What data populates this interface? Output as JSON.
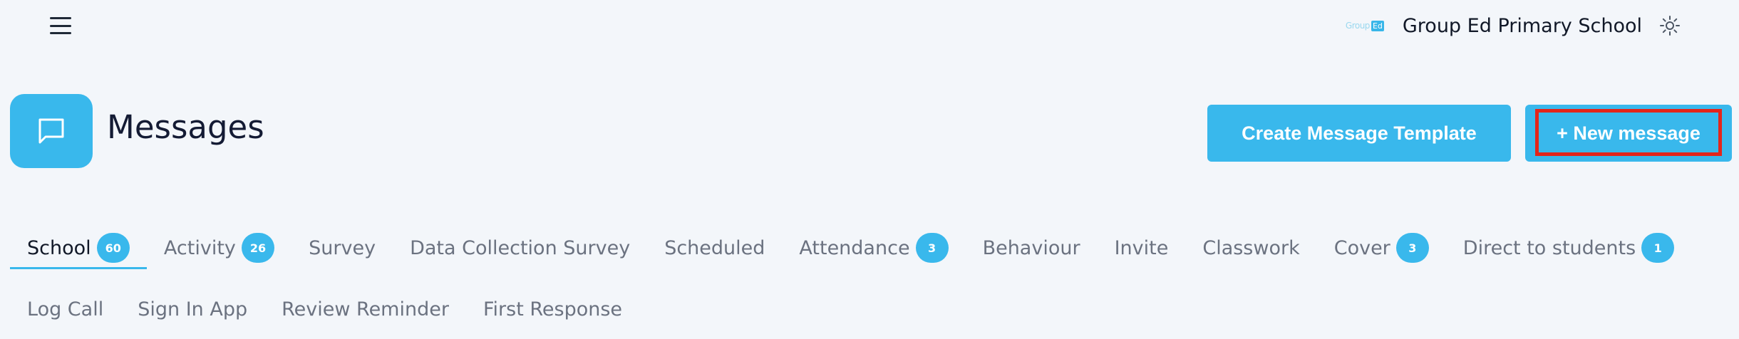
{
  "topbar": {
    "school_logo": {
      "group": "Group",
      "ed": "Ed"
    },
    "school_name": "Group Ed Primary School"
  },
  "header": {
    "title": "Messages",
    "create_template_label": "Create Message Template",
    "new_message_label": "+ New message"
  },
  "tabs": {
    "row1": [
      {
        "label": "School",
        "badge": "60",
        "active": true
      },
      {
        "label": "Activity",
        "badge": "26"
      },
      {
        "label": "Survey"
      },
      {
        "label": "Data Collection Survey"
      },
      {
        "label": "Scheduled"
      },
      {
        "label": "Attendance",
        "badge": "3"
      },
      {
        "label": "Behaviour"
      },
      {
        "label": "Invite"
      },
      {
        "label": "Classwork"
      },
      {
        "label": "Cover",
        "badge": "3"
      },
      {
        "label": "Direct to students",
        "badge": "1"
      }
    ],
    "row2": [
      {
        "label": "Log Call"
      },
      {
        "label": "Sign In App"
      },
      {
        "label": "Review Reminder"
      },
      {
        "label": "First Response"
      }
    ]
  },
  "colors": {
    "accent": "#39b8ec",
    "highlight": "#e3251b",
    "background": "#f3f6fa"
  }
}
